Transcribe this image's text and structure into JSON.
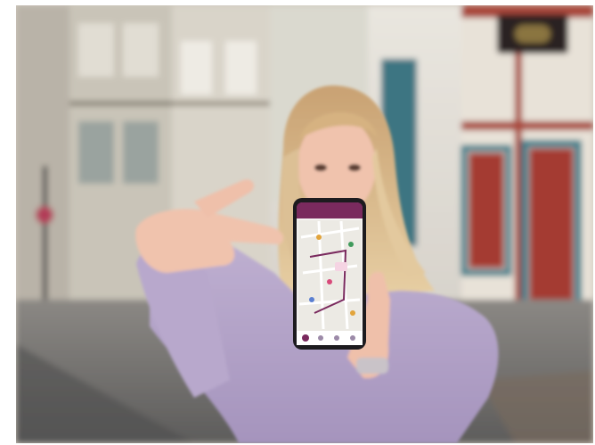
{
  "photo": {
    "subject": "",
    "scene": "",
    "phone_screen": {
      "header_color": "#7a2a5e",
      "bottom_bar_color": "#7a2a5e",
      "icons": [
        "home-icon",
        "map-pin-icon",
        "search-icon",
        "star-icon"
      ]
    }
  },
  "colors": {
    "sweater": "#b3a3c7",
    "hair": "#d9b98c",
    "skin": "#f0c3ad",
    "building_beam": "#a9473a",
    "window_teal": "#2e7d8a",
    "street": "#6c6b6a"
  }
}
